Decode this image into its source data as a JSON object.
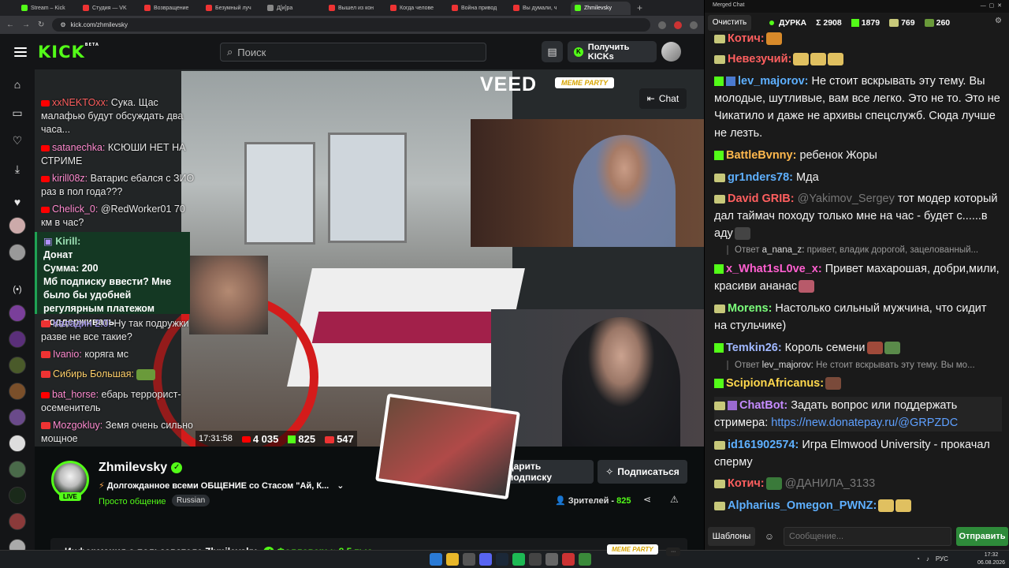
{
  "browser": {
    "tabs": [
      "Stream – Kick",
      "Студия — VK",
      "Возвращение",
      "Безумный луч",
      "Д[и]ра",
      "Вышел из кон",
      "Когда челове",
      "Война привод",
      "Вы думали, ч",
      "Zhmilevsky"
    ],
    "url": "kick.com/zhmilevsky"
  },
  "kick": {
    "logo": "KICK",
    "logo_beta": "BETA",
    "search_placeholder": "Поиск",
    "get_kicks": "Получить KICKs"
  },
  "video": {
    "veed": "VEED",
    "meme_party": "MEME PARTY",
    "chat_button": "Chat",
    "overlay_chat": [
      {
        "user": "xxNEKTOxx:",
        "text": " Сука. Щас малафью будут обсуждать два часа...",
        "color": "#ff5f5f"
      },
      {
        "user": "satanechka:",
        "text": " КСЮШИ НЕТ НА СТРИМЕ",
        "color": "#ff8bd0"
      },
      {
        "user": "kirill08z:",
        "text": " Ватарис ебался с ЗИО раз в пол года???",
        "color": "#ff8bd0"
      },
      {
        "user": "Chelick_0:",
        "text": " @RedWorker01 70 км в час?",
        "color": "#ff8bd0"
      },
      {
        "user": "Каладин 2.0:",
        "text": " Ну так подружки разве не все такие?",
        "color": "#b0a0ff"
      },
      {
        "user": "Ivanio:",
        "text": " коряга мс",
        "color": "#ff8bd0"
      },
      {
        "user": "Сибирь Большая:",
        "text": "",
        "color": "#ffd06a"
      },
      {
        "user": "bat_horse:",
        "text": " ебарь террорист-осеменитель",
        "color": "#ff8bd0"
      },
      {
        "user": "Mozgokluy:",
        "text": " Земя очень сильно мощное",
        "color": "#ff8bd0"
      }
    ],
    "donation": {
      "user": "Kirill:",
      "title": "Донат",
      "amount": "Сумма: 200",
      "text": "Мб подписку ввести? Мне было бы удобней регулярным платежом поддерживать"
    },
    "stats": {
      "time": "17:31:58",
      "youtube": "4 035",
      "kick": "825",
      "vk": "547"
    }
  },
  "channel": {
    "name": "Zhmilevsky",
    "live": "LIVE",
    "title": "Долгожданное всеми ОБЩЕНИЕ со Стасом \"Ай, К...",
    "category": "Просто общение",
    "tag": "Russian",
    "gift_sub": "дарить подписку",
    "subscribe": "Подписаться",
    "viewers_label": "Зрителей - ",
    "viewers": "825",
    "about": "Информация о пользователе Zhmilevsky",
    "followers": "Фолловеры: 8,5 тыс."
  },
  "merged_chat": {
    "window_title": "Merged Chat",
    "clear": "Очистить",
    "channel": "ДУРКА",
    "total": "Σ 2908",
    "kick_count": "1879",
    "yt_count": "769",
    "vk_count": "260",
    "messages": [
      {
        "user": "Котич:",
        "text": "",
        "color": "#ff5f5f"
      },
      {
        "user": "Невезучий:",
        "text": "",
        "color": "#ff5f5f"
      },
      {
        "user": "lev_majorov:",
        "text": " Не стоит вскрывать эту тему. Вы молодые, шутливые, вам все легко. Это не то. Это не Чикатило и даже не архивы спецслужб. Сюда лучше не лезть.",
        "color": "#5eb0ff"
      },
      {
        "user": "BattleBvnny:",
        "text": " ребенок Жоры",
        "color": "#ffb84d"
      },
      {
        "user": "gr1nders78:",
        "text": " Мда",
        "color": "#5eb0ff"
      },
      {
        "user": "David GRIB:",
        "mention": " @Yakimov_Sergey",
        "text": " тот модер который дал таймач походу только мне на час - будет с......в аду",
        "color": "#ff5f5f"
      },
      {
        "user": "x_What1sL0ve_x:",
        "text": " Привет махарошая, добри,мили, красиви ананас",
        "color": "#ff5fd0"
      },
      {
        "user": "Morens:",
        "text": " Настолько сильный мужчина, что сидит на стульчике)",
        "color": "#7bff7b"
      },
      {
        "user": "Temkin26:",
        "text": " Король семени",
        "color": "#a0b8ff"
      },
      {
        "user": "ScipionAfricanus:",
        "text": "",
        "color": "#ffd84d"
      },
      {
        "user": "ChatBot:",
        "text": " Задать вопрос или поддержать стримера: ",
        "link": "https://new.donatepay.ru/@GRPZDC",
        "color": "#c58bff"
      },
      {
        "user": "id161902574:",
        "text": " Игра Elmwood University - прокачал сперму",
        "color": "#5eb0ff"
      },
      {
        "user": "Котич:",
        "mention": " @ДАНИЛА_3133",
        "text": "",
        "color": "#ff5f5f"
      },
      {
        "user": "Alpharius_Omegon_PWNZ:",
        "text": "",
        "color": "#5eb0ff"
      }
    ],
    "replies": [
      {
        "label": "Ответ ",
        "user": "a_nana_z:",
        "text": " привет, владик дорогой, зацелованный..."
      },
      {
        "label": "Ответ ",
        "user": "lev_majorov:",
        "text": " Не стоит вскрывать эту тему. Вы мо..."
      }
    ],
    "templates": "Шаблоны",
    "input_placeholder": "Сообщение...",
    "send": "Отправить"
  },
  "taskbar": {
    "lang": "РУС",
    "time": "17:32",
    "date": "06.08.2026"
  }
}
